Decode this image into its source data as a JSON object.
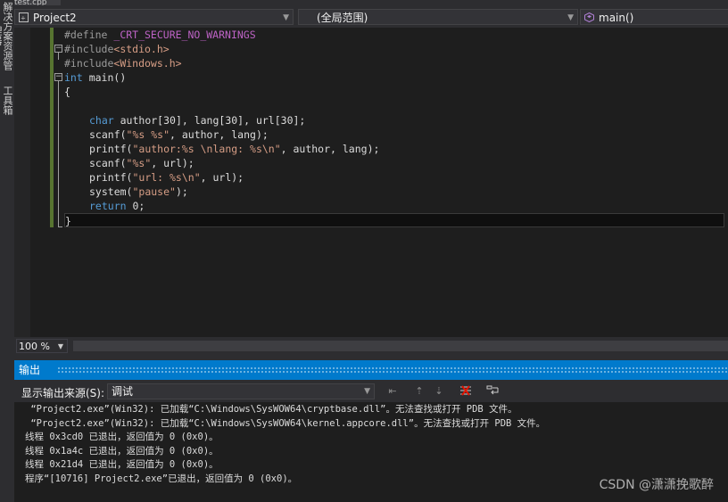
{
  "file_tab": "test.cpp",
  "left_strip": {
    "solution_explorer": "解决方案资源管理器",
    "toolbox": "工具箱"
  },
  "navbar": {
    "project": "Project2",
    "scope": "(全局范围)",
    "member": "main()"
  },
  "code": {
    "l1_kw": "#define ",
    "l1_macro": "_CRT_SECURE_NO_WARNINGS",
    "l2_kw": "#include",
    "l2_inc": "<stdio.h>",
    "l3_kw": "#include",
    "l3_inc": "<Windows.h>",
    "l4_type": "int",
    "l4_rest": " main()",
    "l5": "{",
    "l6": "",
    "l7_kw": "char",
    "l7_rest": " author[30], lang[30], url[30];",
    "l8_a": "scanf(",
    "l8_s": "\"%s %s\"",
    "l8_b": ", author, lang);",
    "l9_a": "printf(",
    "l9_s": "\"author:%s \\nlang: %s\\n\"",
    "l9_b": ", author, lang);",
    "l10_a": "scanf(",
    "l10_s": "\"%s\"",
    "l10_b": ", url);",
    "l11_a": "printf(",
    "l11_s": "\"url: %s\\n\"",
    "l11_b": ", url);",
    "l12_a": "system(",
    "l12_s": "\"pause\"",
    "l12_b": ");",
    "l13_kw": "return",
    "l13_rest": " 0;",
    "l14": "}"
  },
  "zoom": "100 %",
  "output": {
    "title": "输出",
    "source_label": "显示输出来源(S):",
    "source_value": "调试",
    "lines": [
      " “Project2.exe”(Win32): 已加载“C:\\Windows\\SysWOW64\\cryptbase.dll”。无法查找或打开 PDB 文件。",
      " “Project2.exe”(Win32): 已加载“C:\\Windows\\SysWOW64\\kernel.appcore.dll”。无法查找或打开 PDB 文件。",
      "线程 0x3cd0 已退出，返回值为 0 (0x0)。",
      "线程 0x1a4c 已退出，返回值为 0 (0x0)。",
      "线程 0x21d4 已退出，返回值为 0 (0x0)。",
      "程序“[10716] Project2.exe”已退出，返回值为 0 (0x0)。"
    ]
  },
  "watermark": "CSDN @潇潇挽歌醉",
  "colors": {
    "accent": "#007acc",
    "editor_bg": "#1e1e1e",
    "keyword": "#569cd6",
    "string": "#d69d85",
    "macro": "#bd63c5",
    "change_bar": "#577430"
  }
}
